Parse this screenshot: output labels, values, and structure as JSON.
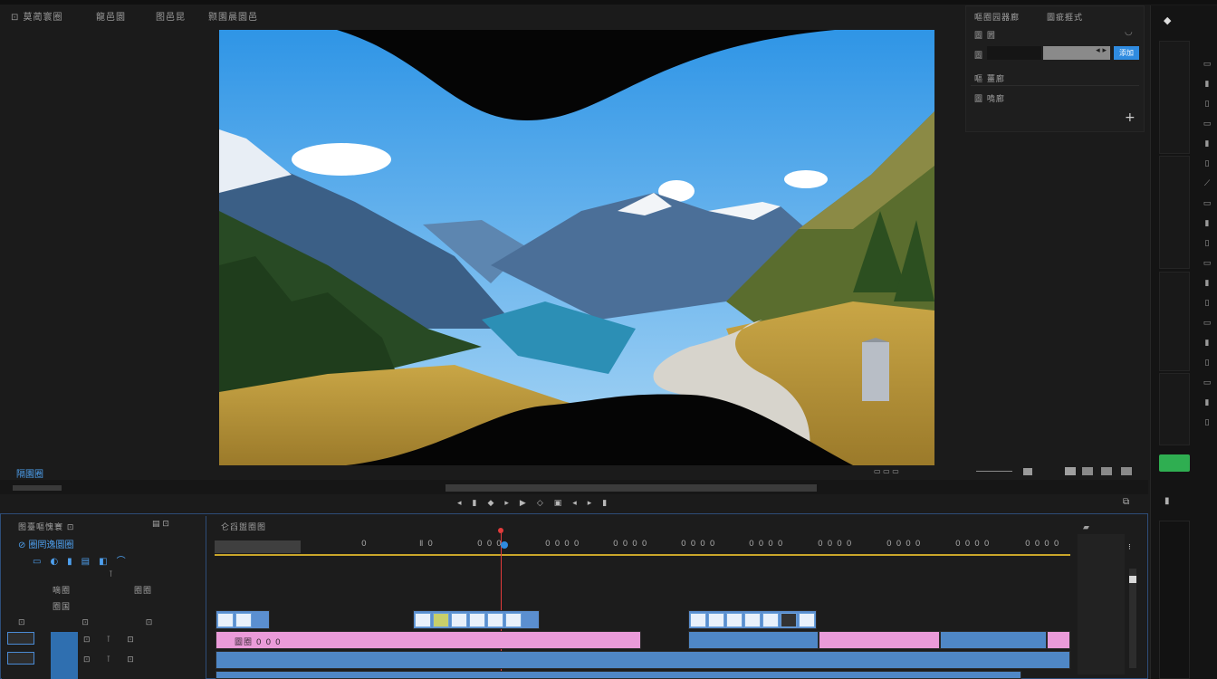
{
  "menu": {
    "item_1": "⊡ 莫蔺寰圈",
    "item_2": "龍邑圜",
    "item_3": "图邑昆",
    "item_4": "颢園晨圜邑"
  },
  "inspector": {
    "title": "嘔圈园器廊",
    "tab": "圖疵捱式",
    "row1_label": "圖 圌",
    "row2_label": "圖 圝",
    "row2_value": "◂ ▸",
    "row2_button": "添加",
    "row3_label": "嘔 薑廊",
    "row4_label": "圖 嘵廊",
    "add_icon": "+"
  },
  "viewer": {
    "label": "隔園圈",
    "toolbar_right": "▭ ▭ ▭"
  },
  "timeline": {
    "panel_title": "图臺嘔愧寰 ⊡",
    "tab_title": "仑舀盥圈图",
    "subhead": "⊘ 圈罔逸圜圈",
    "row_labels": [
      "嘀圈",
      "圈圈",
      "圈国"
    ],
    "ruler_ticks": [
      "0",
      "Ⅱ 0",
      "0 0 0",
      "0 0 0 0",
      "0 0 0 0",
      "0 0 0 0",
      "0 0 0 0",
      "0 0 0 0",
      "0 0 0 0",
      "0 0 0 0",
      "0 0 0 0",
      "0 0 0 0"
    ],
    "clip_label": "圖圈 0 0 0"
  },
  "colors": {
    "accent": "#2f8be0",
    "playhead": "#e23b3b",
    "clip_blue": "#5b8fd0",
    "clip_pink": "#ea9bd9",
    "green_button": "#2fae51"
  }
}
